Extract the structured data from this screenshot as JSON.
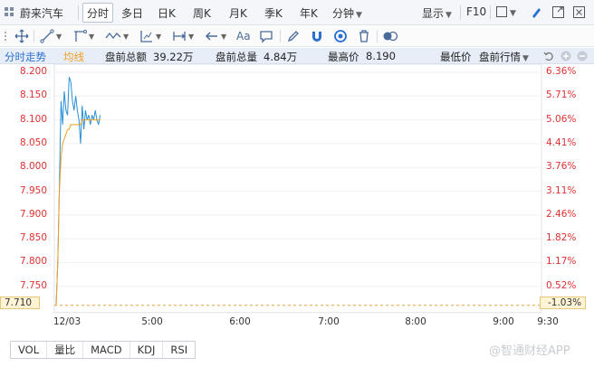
{
  "topbar": {
    "stock_name": "蔚来汽车",
    "periods": [
      "分时",
      "多日",
      "日K",
      "周K",
      "月K",
      "季K",
      "年K",
      "分钟"
    ],
    "display_label": "显示",
    "f10_label": "F10"
  },
  "toolbar": {
    "text_tool": "Aa"
  },
  "info": {
    "tab_label": "分时走势",
    "avg_label": "均线",
    "premarket_amount_label": "盘前总额",
    "premarket_amount_value": "39.22万",
    "premarket_volume_label": "盘前总量",
    "premarket_volume_value": "4.84万",
    "high_label": "最高价",
    "high_value": "8.190",
    "low_label": "最低价",
    "mode_label": "盘前行情"
  },
  "chart_data": {
    "type": "line",
    "title": "",
    "x_ticks": [
      "12/03",
      "5:00",
      "6:00",
      "7:00",
      "8:00",
      "9:00",
      "9:30"
    ],
    "y_left_ticks": [
      "8.200",
      "8.150",
      "8.100",
      "8.050",
      "8.000",
      "7.950",
      "7.900",
      "7.850",
      "7.800",
      "7.750"
    ],
    "y_right_ticks": [
      "6.36%",
      "5.71%",
      "5.06%",
      "4.41%",
      "3.76%",
      "3.11%",
      "2.46%",
      "1.82%",
      "1.17%",
      "0.52%"
    ],
    "ylim": [
      7.71,
      8.2
    ],
    "prev_close": "7.710",
    "prev_close_pct": "-1.03%",
    "series": [
      {
        "kind": "price",
        "color": "#2a8fd6",
        "x": [
          0,
          1,
          2,
          3,
          4,
          5,
          6,
          7,
          8,
          9,
          10,
          11,
          12,
          13,
          14,
          15,
          16,
          17,
          18,
          19,
          20,
          21,
          22,
          23,
          24,
          25,
          26,
          27
        ],
        "values": [
          7.71,
          7.8,
          7.96,
          8.14,
          8.09,
          8.16,
          8.12,
          8.11,
          8.19,
          8.18,
          8.14,
          8.12,
          8.15,
          8.12,
          8.1,
          8.05,
          8.13,
          8.08,
          8.12,
          8.1,
          8.11,
          8.09,
          8.11,
          8.1,
          8.12,
          8.1,
          8.09,
          8.11
        ]
      },
      {
        "kind": "average",
        "color": "#f0a020",
        "x": [
          0,
          1,
          2,
          3,
          4,
          5,
          6,
          7,
          8,
          9,
          10,
          11,
          12,
          13,
          14,
          15,
          16,
          17,
          18,
          19,
          20,
          21,
          22,
          23,
          24,
          25,
          26,
          27
        ],
        "values": [
          7.71,
          7.8,
          7.95,
          8.02,
          8.05,
          8.06,
          8.07,
          8.08,
          8.08,
          8.09,
          8.09,
          8.09,
          8.09,
          8.09,
          8.09,
          8.09,
          8.1,
          8.1,
          8.1,
          8.1,
          8.1,
          8.1,
          8.1,
          8.1,
          8.1,
          8.1,
          8.1,
          8.1
        ]
      }
    ]
  },
  "indicator_tabs": [
    "VOL",
    "量比",
    "MACD",
    "KDJ",
    "RSI"
  ],
  "watermark": "@智通财经APP",
  "colors": {
    "price_line": "#2a8fd6",
    "average_line": "#f0a020",
    "axis_text": "#e03030",
    "accent": "#2a6fd0"
  }
}
